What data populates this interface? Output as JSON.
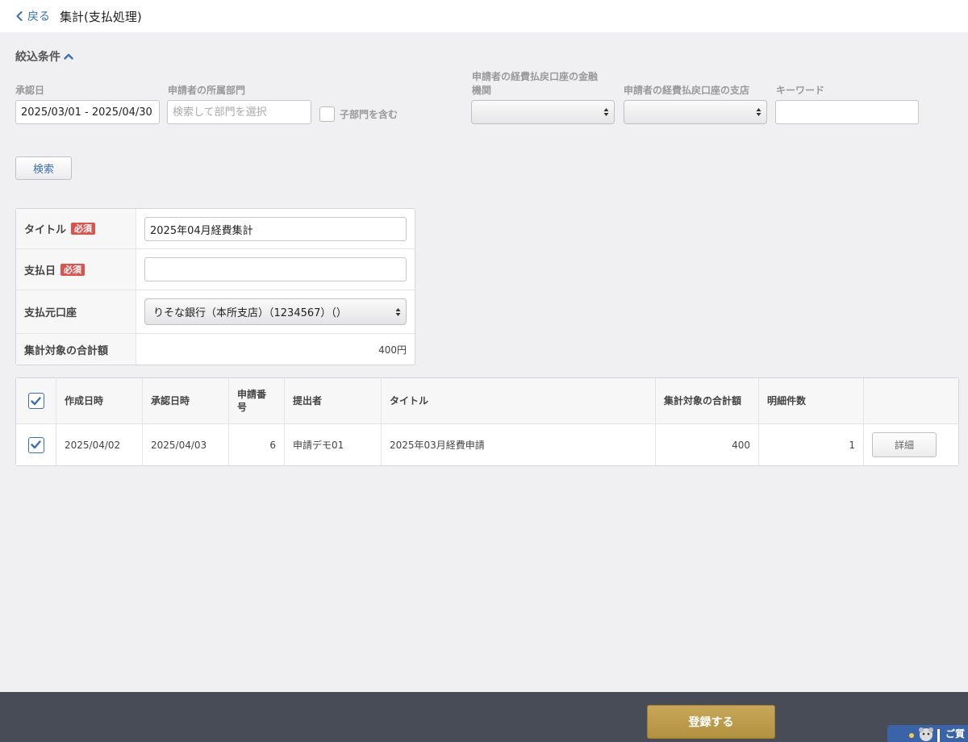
{
  "header": {
    "back_label": "戻る",
    "title": "集計(支払処理)"
  },
  "filters": {
    "section_title": "絞込条件",
    "approval_date_label": "承認日",
    "approval_date_value": "2025/03/01 - 2025/04/30",
    "department_label": "申請者の所属部門",
    "department_placeholder": "検索して部門を選択",
    "include_sub_label": "子部門を含む",
    "bank_label_line1": "申請者の経費払戻口座の金融",
    "bank_label_line2": "機関",
    "branch_label": "申請者の経費払戻口座の支店",
    "keyword_label": "キーワード",
    "search_button": "検索"
  },
  "form": {
    "title_label": "タイトル",
    "required_badge": "必須",
    "title_value": "2025年04月経費集計",
    "pay_date_label": "支払日",
    "source_account_label": "支払元口座",
    "source_account_value": "りそな銀行（本所支店）（1234567）（）",
    "total_label": "集計対象の合計額",
    "total_value": "400円"
  },
  "table": {
    "columns": [
      "作成日時",
      "承認日時",
      "申請番号",
      "提出者",
      "タイトル",
      "集計対象の合計額",
      "明細件数"
    ],
    "col_number_line1": "申請番",
    "col_number_line2": "号",
    "rows": [
      {
        "created": "2025/04/02",
        "approved": "2025/04/03",
        "number": "6",
        "submitter": "申請デモ01",
        "title": "2025年03月経費申請",
        "total": "400",
        "count": "1",
        "detail_button": "詳細"
      }
    ]
  },
  "footer": {
    "register_button": "登録する",
    "help_tab_label": "ご質"
  },
  "colors": {
    "accent": "#3a6fb0",
    "required": "#d9534f",
    "footer_bg": "#474c57",
    "register_button": "#b99a4a"
  }
}
